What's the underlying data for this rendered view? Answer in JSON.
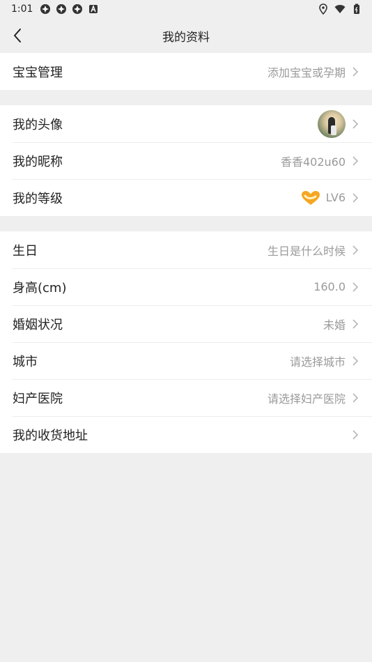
{
  "status_bar": {
    "time": "1:01",
    "icons": [
      "app-notification-icon",
      "app-notification-icon",
      "app-notification-icon",
      "a-badge-icon"
    ],
    "right_icons": [
      "location-icon",
      "wifi-icon",
      "battery-icon"
    ]
  },
  "header": {
    "title": "我的资料"
  },
  "groups": [
    [
      {
        "label": "宝宝管理",
        "value": "添加宝宝或孕期"
      }
    ],
    [
      {
        "label": "我的头像",
        "value": ""
      },
      {
        "label": "我的昵称",
        "value": "香香402u60"
      },
      {
        "label": "我的等级",
        "value": "LV6"
      }
    ],
    [
      {
        "label": "生日",
        "value": "生日是什么时候"
      },
      {
        "label": "身高(cm)",
        "value": "160.0"
      },
      {
        "label": "婚姻状况",
        "value": "未婚"
      },
      {
        "label": "城市",
        "value": "请选择城市"
      },
      {
        "label": "妇产医院",
        "value": "请选择妇产医院"
      },
      {
        "label": "我的收货地址",
        "value": ""
      }
    ]
  ],
  "colors": {
    "background": "#efefef",
    "row": "#ffffff",
    "text": "#222222",
    "muted": "#9a9a9a",
    "level_heart": "#f5a623"
  }
}
